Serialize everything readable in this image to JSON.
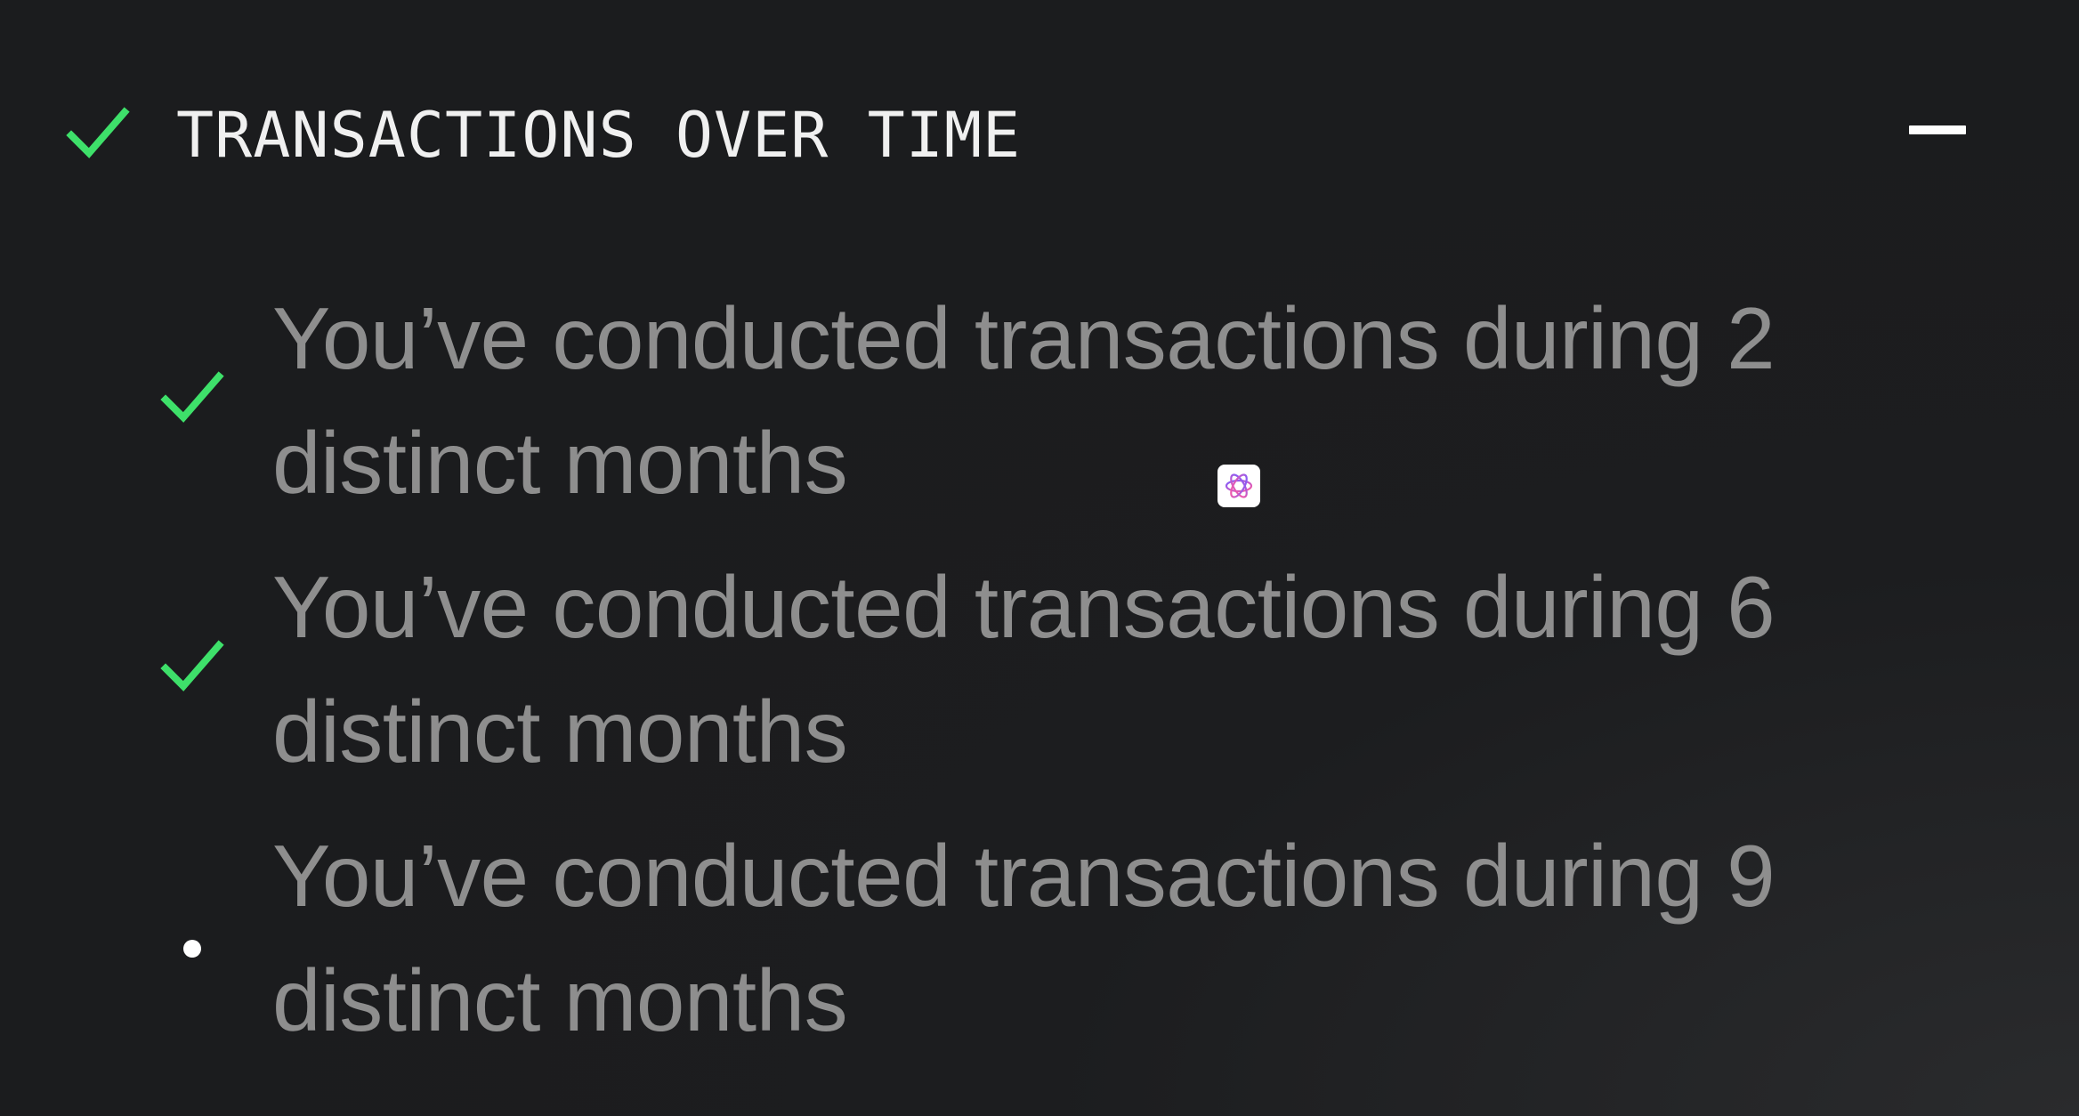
{
  "section": {
    "title": "TRANSACTIONS OVER TIME",
    "status_icon": "checkmark-icon",
    "collapse_icon": "minus-icon",
    "accent_color": "#3ee06a"
  },
  "criteria": [
    {
      "text": "You’ve conducted transactions during 2 distinct months",
      "status": "completed",
      "icon": "checkmark-icon"
    },
    {
      "text": "You’ve conducted transactions during 6 distinct months",
      "status": "completed",
      "icon": "checkmark-icon"
    },
    {
      "text": "You’ve conducted transactions during 9 distinct months",
      "status": "pending",
      "icon": "bullet-dot-icon"
    }
  ],
  "overlay": {
    "icon": "openai-logo-icon"
  }
}
